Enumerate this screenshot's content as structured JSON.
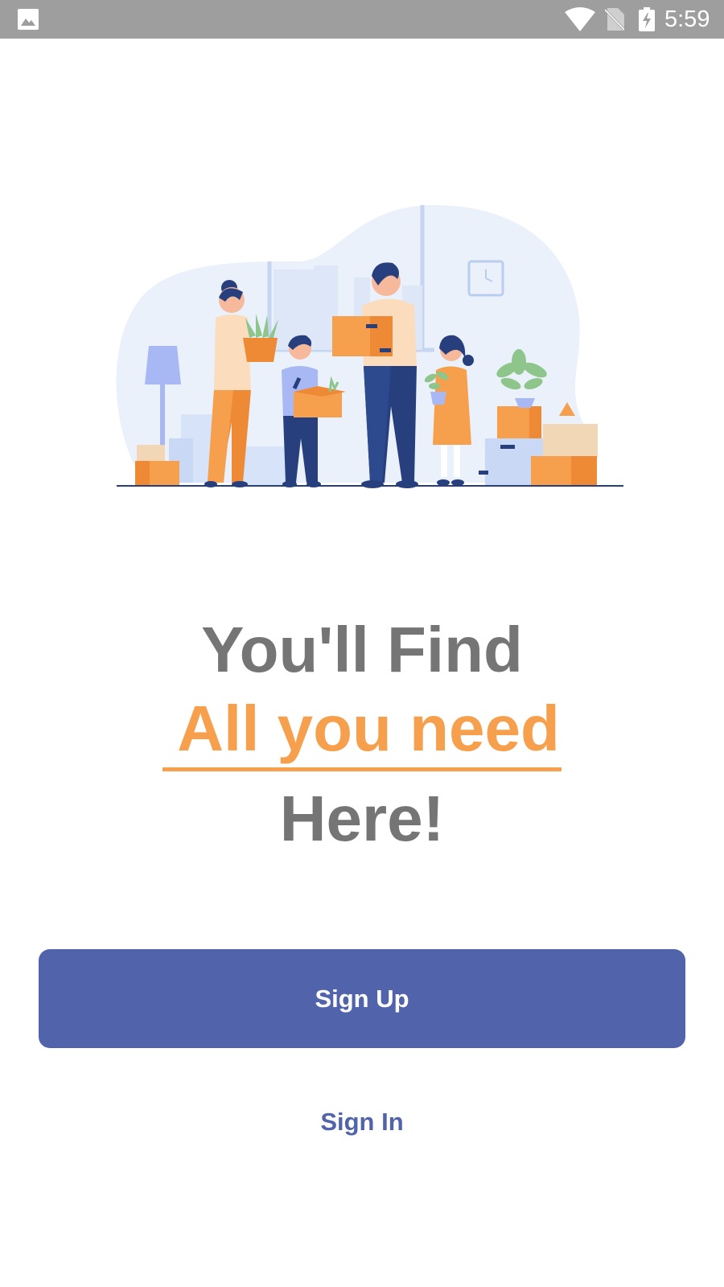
{
  "status_bar": {
    "time": "5:59",
    "icons": [
      "gallery-icon",
      "wifi-icon",
      "no-sim-icon",
      "battery-charging-icon"
    ]
  },
  "illustration": {
    "icon": "family-moving-illustration"
  },
  "headline": {
    "line1": "You'll Find",
    "line2": "All you need",
    "line3": "Here!"
  },
  "actions": {
    "signup_label": "Sign Up",
    "signin_label": "Sign In"
  },
  "colors": {
    "status_bar": "#9e9e9e",
    "headline_gray": "#757575",
    "accent_orange": "#f6a04d",
    "primary_blue": "#5063ab"
  }
}
